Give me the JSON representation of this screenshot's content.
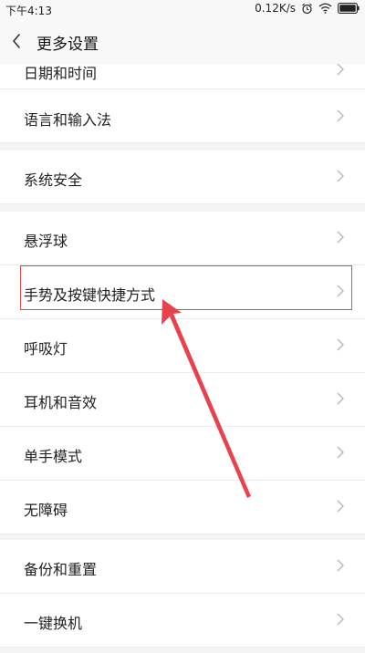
{
  "status_bar": {
    "time": "下午4:13",
    "net_speed": "0.12K/s"
  },
  "header": {
    "title": "更多设置",
    "back_icon": "chevron-left-icon"
  },
  "groups": [
    {
      "items": [
        {
          "label": "日期和时间",
          "partial": true
        },
        {
          "label": "语言和输入法"
        }
      ]
    },
    {
      "items": [
        {
          "label": "系统安全"
        }
      ]
    },
    {
      "items": [
        {
          "label": "悬浮球"
        },
        {
          "label": "手势及按键快捷方式",
          "highlighted": true
        },
        {
          "label": "呼吸灯"
        },
        {
          "label": "耳机和音效"
        },
        {
          "label": "单手模式"
        },
        {
          "label": "无障碍"
        }
      ]
    },
    {
      "items": [
        {
          "label": "备份和重置"
        },
        {
          "label": "一键换机"
        }
      ]
    }
  ],
  "colors": {
    "highlight": "#e8424c",
    "row_bg": "#ffffff",
    "page_bg": "#f4f4f4",
    "chevron": "#b5b5b5"
  },
  "icons": {
    "row_chevron": "chevron-right-icon",
    "annotation": "red-arrow-annotation"
  }
}
